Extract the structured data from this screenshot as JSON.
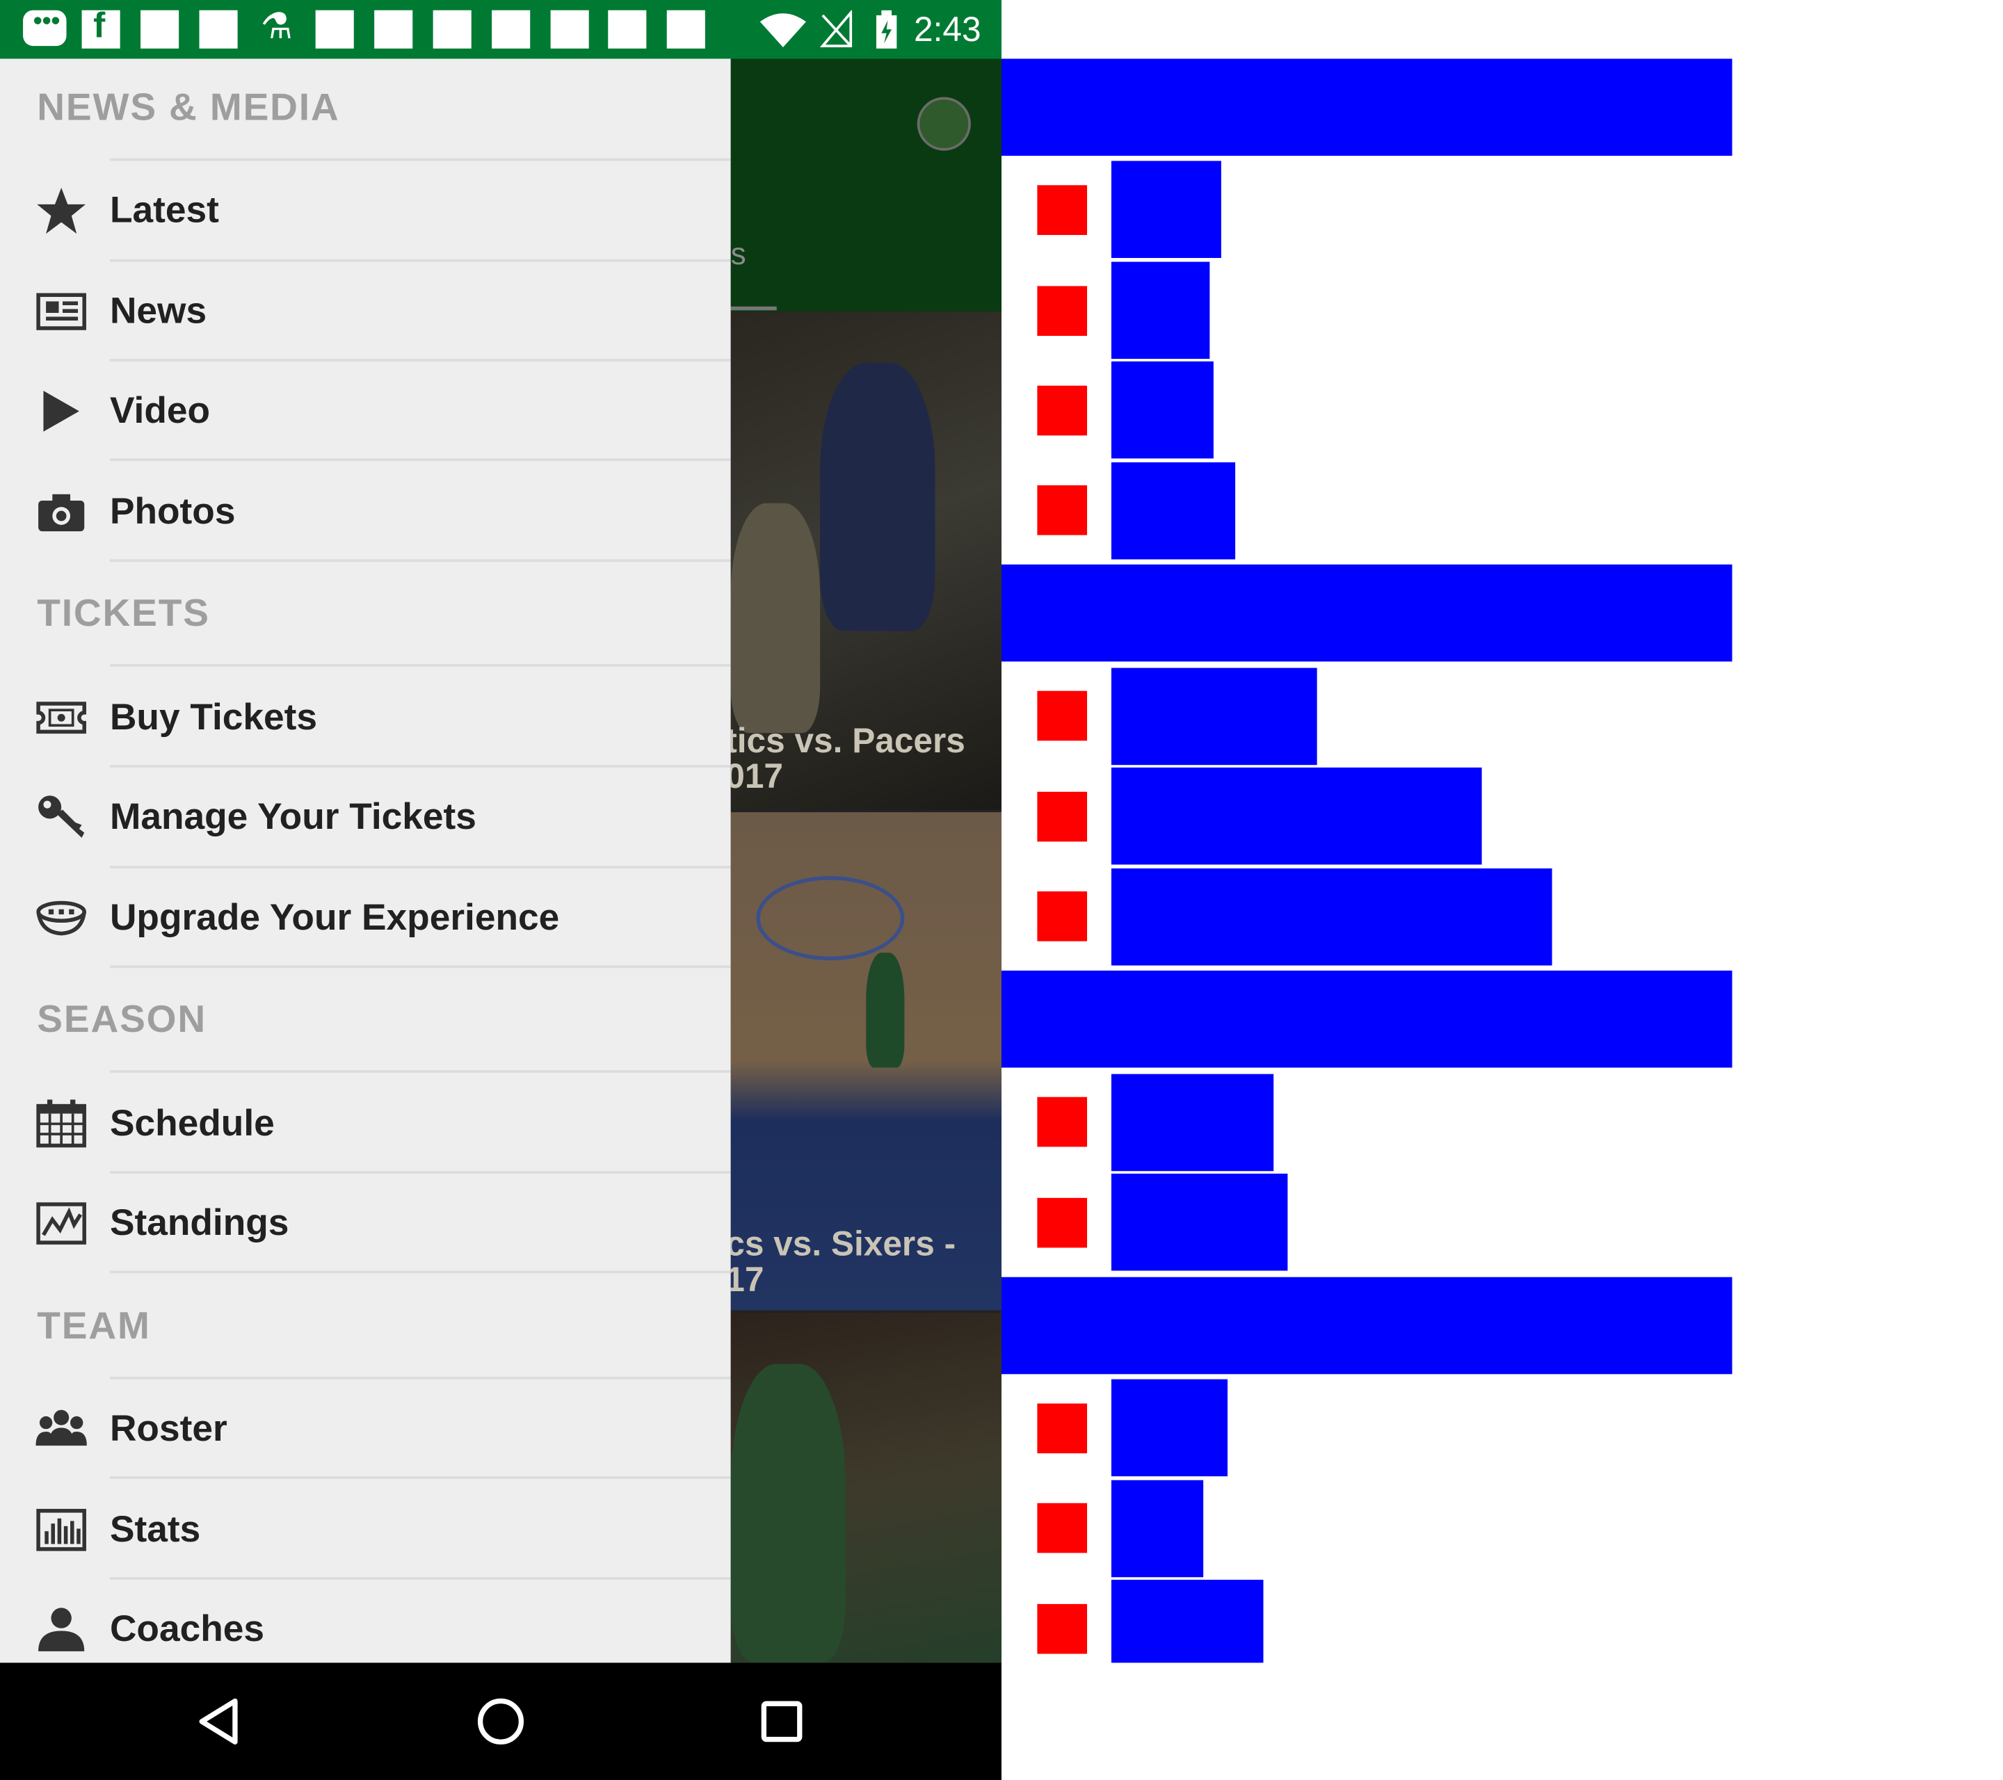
{
  "status_bar": {
    "time": "2:43",
    "left_icons": [
      "chat-bubble-icon",
      "facebook-icon",
      "square-icon",
      "square-icon",
      "microscope-icon",
      "square-icon",
      "square-icon",
      "square-icon",
      "square-icon",
      "square-icon",
      "square-icon"
    ],
    "right_icons": [
      "wifi-icon",
      "no-signal-icon",
      "battery-charging-icon"
    ]
  },
  "drawer": {
    "sections": [
      {
        "title": "NEWS & MEDIA",
        "items": [
          {
            "label": "Latest",
            "icon": "star-icon"
          },
          {
            "label": "News",
            "icon": "newspaper-icon"
          },
          {
            "label": "Video",
            "icon": "play-icon"
          },
          {
            "label": "Photos",
            "icon": "camera-icon"
          }
        ]
      },
      {
        "title": "TICKETS",
        "items": [
          {
            "label": "Buy Tickets",
            "icon": "ticket-icon"
          },
          {
            "label": "Manage Your Tickets",
            "icon": "key-icon"
          },
          {
            "label": "Upgrade Your Experience",
            "icon": "arena-icon"
          }
        ]
      },
      {
        "title": "SEASON",
        "items": [
          {
            "label": "Schedule",
            "icon": "calendar-icon"
          },
          {
            "label": "Standings",
            "icon": "trend-chart-icon"
          }
        ]
      },
      {
        "title": "TEAM",
        "items": [
          {
            "label": "Roster",
            "icon": "group-icon"
          },
          {
            "label": "Stats",
            "icon": "bar-stats-icon"
          },
          {
            "label": "Coaches",
            "icon": "person-icon"
          }
        ]
      }
    ]
  },
  "background_app": {
    "tab_fragment": "s",
    "cards": [
      {
        "caption_line1": "tics vs. Pacers",
        "caption_line2": "017"
      },
      {
        "caption_line1": "cs vs. Sixers -",
        "caption_line2": "17"
      },
      {
        "caption_line1": "",
        "caption_line2": ""
      }
    ]
  },
  "nav_bar": {
    "buttons": [
      "back-icon",
      "home-icon",
      "recents-icon"
    ]
  },
  "colors": {
    "status_bar": "#007a33",
    "drawer_bg": "#eeeeee",
    "section_title": "#9e9e9e",
    "item_text": "#212121",
    "overlay_blue": "#0000ff",
    "overlay_red": "#ff0000"
  }
}
